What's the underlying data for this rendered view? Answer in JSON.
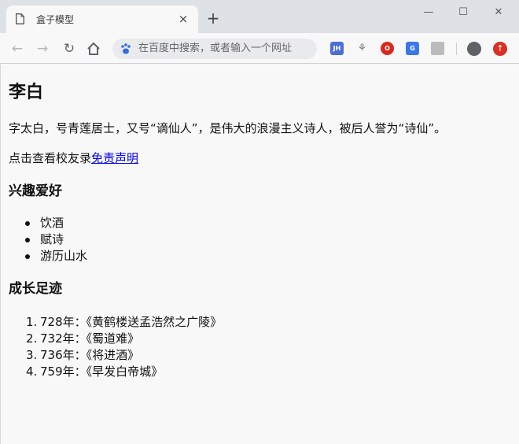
{
  "browser": {
    "tab_title": "盒子模型",
    "tab_close": "×",
    "new_tab": "+",
    "window": {
      "minimize": "—",
      "maximize": "☐",
      "close": "✕"
    },
    "omnibox_placeholder": "在百度中搜索，或者输入一个网址",
    "extensions": [
      {
        "name": "jh-extension-icon",
        "label": "JH",
        "color": "#4b6fd6"
      },
      {
        "name": "extension-icon",
        "label": "",
        "color": "#777777"
      },
      {
        "name": "opera-extension-icon",
        "label": "",
        "color": "#d9291c"
      },
      {
        "name": "translate-extension-icon",
        "label": "",
        "color": "#3b78e7"
      },
      {
        "name": "folder-extension-icon",
        "label": "",
        "color": "#bbbbbb"
      }
    ]
  },
  "page": {
    "title": "李白",
    "intro": "字太白，号青莲居士，又号“谪仙人”，是伟大的浪漫主义诗人，被后人誉为“诗仙”。",
    "link_prefix": "点击查看校友录",
    "link_text": "免责声明",
    "hobbies_heading": "兴趣爱好",
    "hobbies": [
      "饮酒",
      "赋诗",
      "游历山水"
    ],
    "growth_heading": "成长足迹",
    "growth": [
      {
        "num": "1.",
        "text": "728年：《黄鹤楼送孟浩然之广陵》"
      },
      {
        "num": "2.",
        "text": "732年：《蜀道难》"
      },
      {
        "num": "3.",
        "text": "736年：《将进酒》"
      },
      {
        "num": "4.",
        "text": "759年：《早发白帝城》"
      }
    ]
  }
}
